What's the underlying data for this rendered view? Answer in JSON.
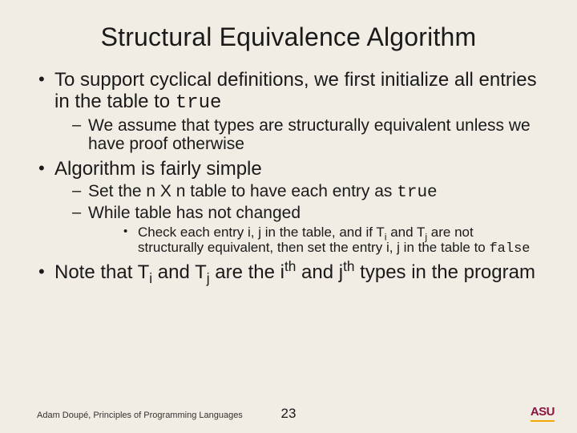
{
  "title": "Structural Equivalence Algorithm",
  "bullets": {
    "b1": "To support cyclical definitions, we first initialize all entries in the table to ",
    "b1_code": "true",
    "b1_sub1": "We assume that types are structurally equivalent unless we have proof otherwise",
    "b2": "Algorithm is fairly simple",
    "b2_sub1_a": "Set the n X n table to have each entry as ",
    "b2_sub1_code": "true",
    "b2_sub2": "While table has not changed",
    "b2_sub2_sub_a": "Check each entry i, j in the table, and if T",
    "b2_sub2_sub_b": " and T",
    "b2_sub2_sub_c": " are not structurally equivalent, then set the entry i, j in the table to ",
    "b2_sub2_sub_code": "false",
    "b3_a": "Note that T",
    "b3_b": " and T",
    "b3_c": " are the i",
    "b3_d": " and j",
    "b3_e": " types in the program",
    "sub_i": "i",
    "sub_j": "j",
    "sup_th": "th"
  },
  "footer": "Adam Doupé, Principles of Programming Languages",
  "page_number": "23",
  "logo": {
    "text": "ASU"
  }
}
